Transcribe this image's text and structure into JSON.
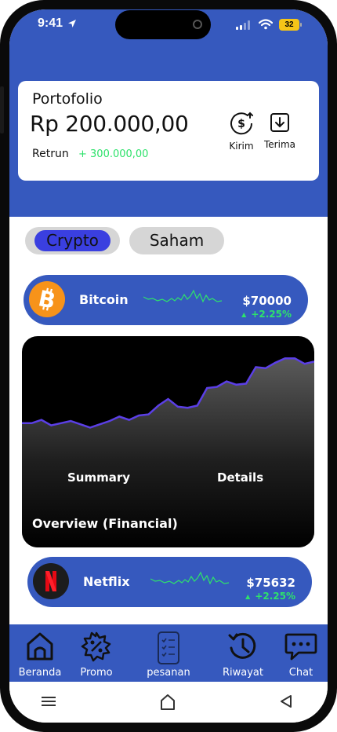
{
  "status_bar": {
    "time": "9:41",
    "battery": "32"
  },
  "portfolio": {
    "title": "Portofolio",
    "balance": "Rp 200.000,00",
    "return_label": "Retrun",
    "return_value": "+ 300.000,00",
    "actions": [
      {
        "label": "Kirim",
        "icon": "dollar-send-icon"
      },
      {
        "label": "Terima",
        "icon": "download-icon"
      }
    ]
  },
  "tabs": [
    {
      "label": "Crypto",
      "active": true
    },
    {
      "label": "Saham",
      "active": false
    }
  ],
  "assets": [
    {
      "name": "Bitcoin",
      "price": "$70000",
      "change": "+2.25%",
      "logo": "bitcoin-logo",
      "color": "#f7931a"
    },
    {
      "name": "Netflix",
      "price": "$75632",
      "change": "+2.25%",
      "logo": "netflix-logo",
      "color": "#e50914"
    }
  ],
  "overview": {
    "summary_label": "Summary",
    "details_label": "Details",
    "title": "Overview (Financial)",
    "series": [
      0.28,
      0.28,
      0.31,
      0.26,
      0.28,
      0.3,
      0.27,
      0.24,
      0.27,
      0.3,
      0.34,
      0.31,
      0.35,
      0.36,
      0.44,
      0.5,
      0.43,
      0.42,
      0.44,
      0.6,
      0.61,
      0.66,
      0.63,
      0.64,
      0.79,
      0.78,
      0.83,
      0.87,
      0.87,
      0.82,
      0.84
    ]
  },
  "bottom_nav": [
    {
      "label": "Beranda",
      "icon": "home-icon"
    },
    {
      "label": "Promo",
      "icon": "promo-badge-icon"
    },
    {
      "label": "pesanan",
      "icon": "order-list-icon"
    },
    {
      "label": "Riwayat",
      "icon": "history-icon"
    },
    {
      "label": "Chat",
      "icon": "chat-icon"
    }
  ],
  "colors": {
    "primary": "#3659be",
    "positive": "#2ee26b",
    "accent": "#3a3fe0",
    "chart_line": "#5b3fe6"
  }
}
